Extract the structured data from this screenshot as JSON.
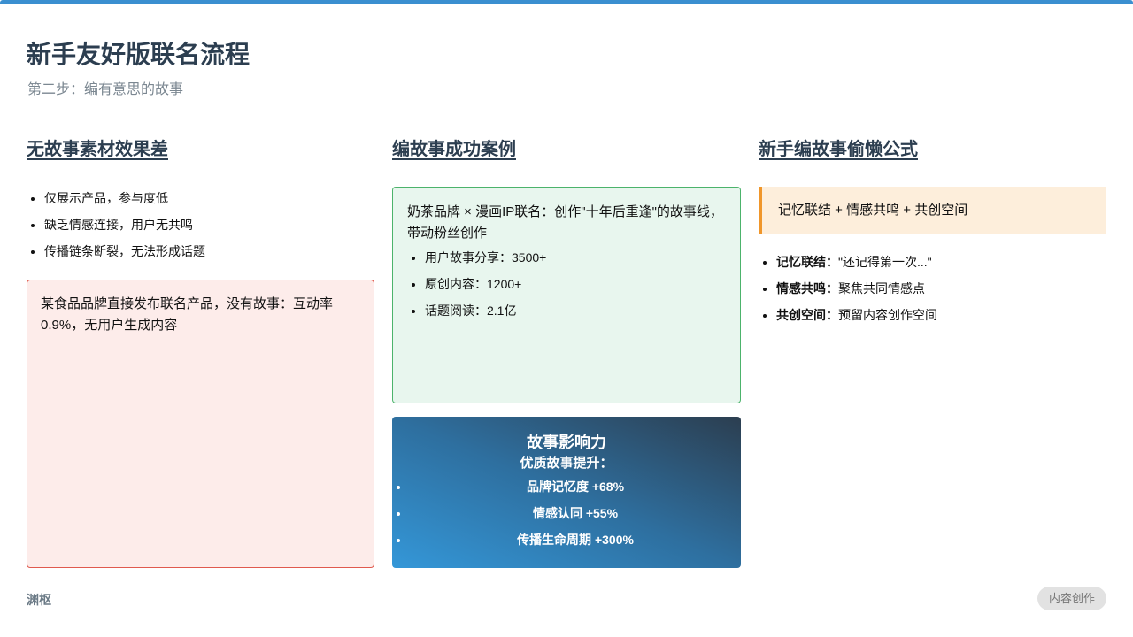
{
  "header": {
    "title": "新手友好版联名流程",
    "subtitle": "第二步：编有意思的故事"
  },
  "col1": {
    "title": "无故事素材效果差",
    "points": [
      "仅展示产品，参与度低",
      "缺乏情感连接，用户无共鸣",
      "传播链条断裂，无法形成话题"
    ],
    "case_text": "某食品品牌直接发布联名产品，没有故事：互动率0.9%，无用户生成内容"
  },
  "col2": {
    "title": "编故事成功案例",
    "case_text": "奶茶品牌 × 漫画IP联名：创作\"十年后重逢\"的故事线，带动粉丝创作",
    "stats": [
      "用户故事分享：3500+",
      "原创内容：1200+",
      "话题阅读：2.1亿"
    ],
    "impact": {
      "title": "故事影响力",
      "subtitle": "优质故事提升：",
      "items": [
        "品牌记忆度 +68%",
        "情感认同 +55%",
        "传播生命周期 +300%"
      ]
    }
  },
  "col3": {
    "title": "新手编故事偷懒公式",
    "formula": "记忆联结 + 情感共鸣 + 共创空间",
    "items": [
      {
        "label": "记忆联结：",
        "text": "\"还记得第一次...\""
      },
      {
        "label": "情感共鸣：",
        "text": "聚焦共同情感点"
      },
      {
        "label": "共创空间：",
        "text": "预留内容创作空间"
      }
    ]
  },
  "footer": {
    "brand": "渊枢",
    "tag": "内容创作"
  },
  "colors": {
    "accent": "#3a8fd0",
    "fail_border": "#e05a4e",
    "success_border": "#4cb36b",
    "formula_border": "#f0962a"
  }
}
